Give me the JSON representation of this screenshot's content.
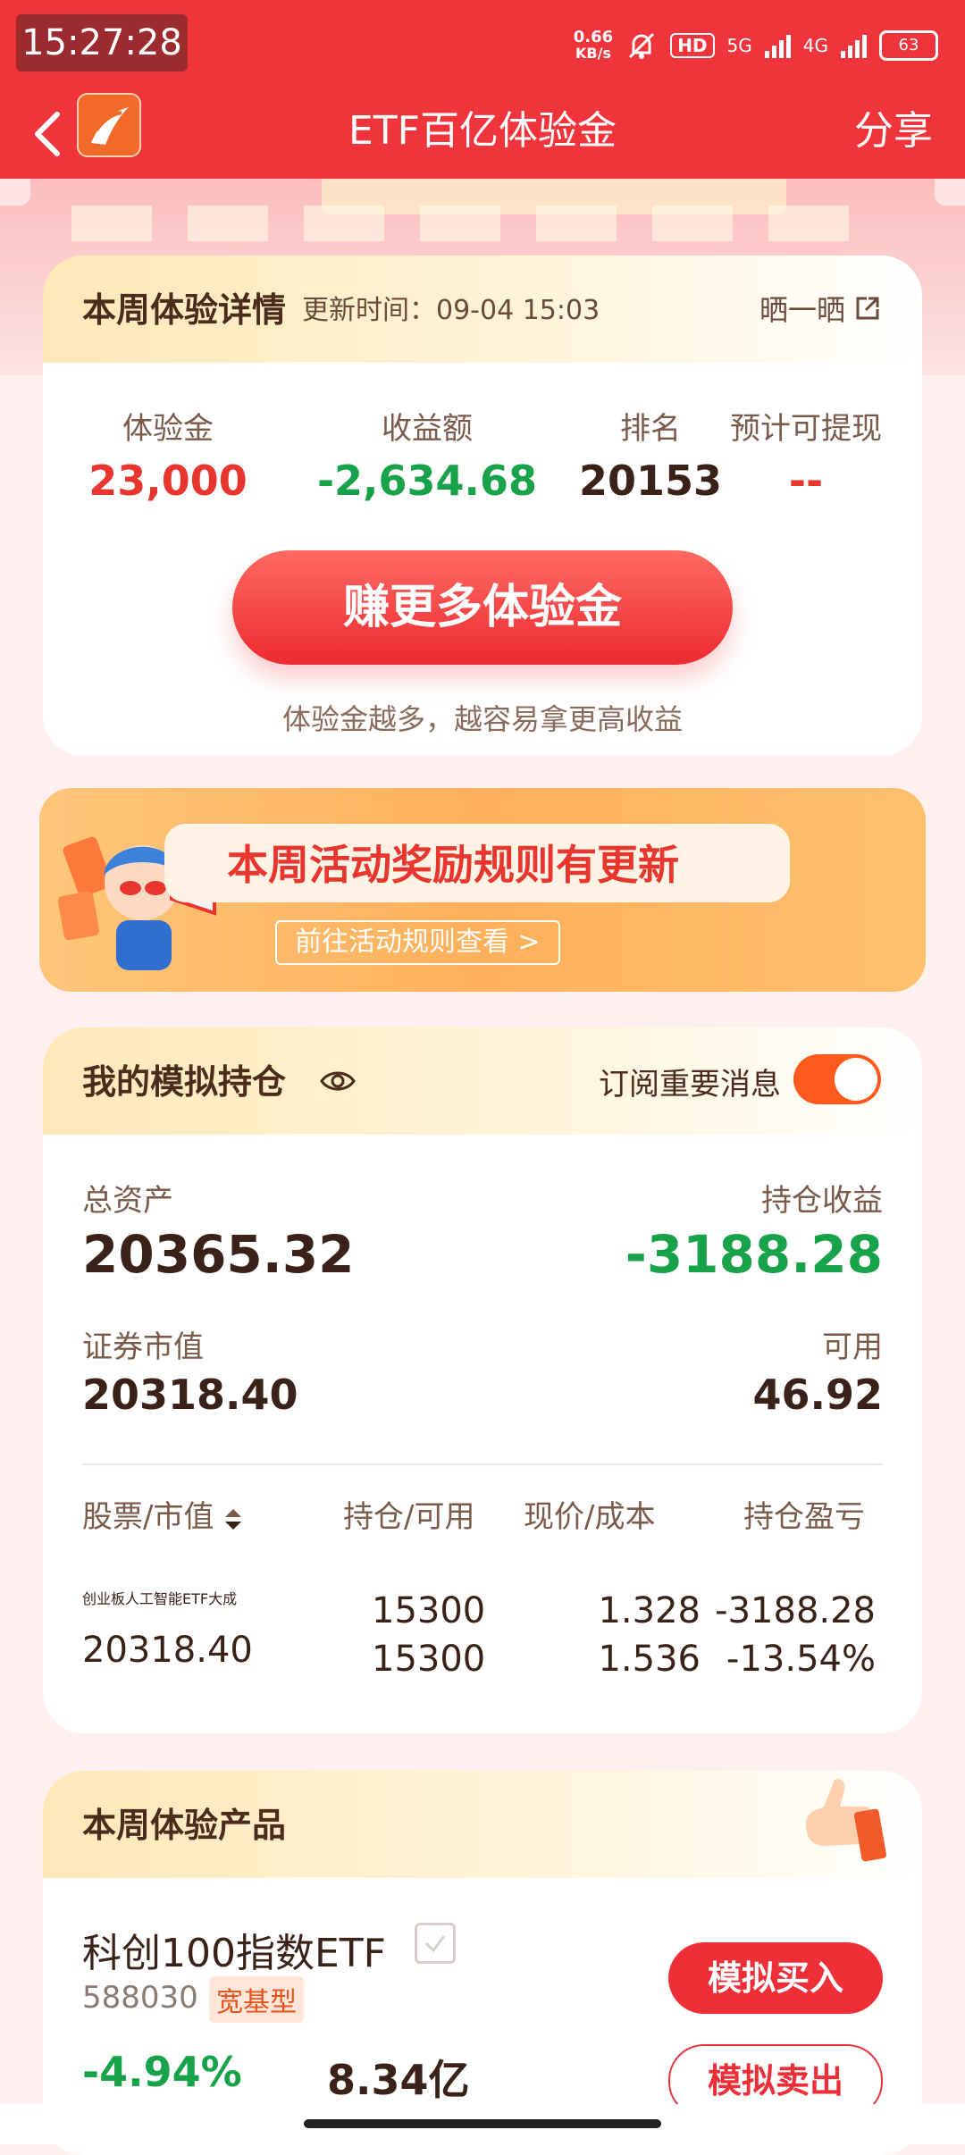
{
  "status_bar": {
    "time": "15:27:28",
    "net_speed": "0.66",
    "net_unit": "KB/s",
    "hd": "HD",
    "sig1": "5G",
    "sig2": "4G",
    "battery": "63"
  },
  "nav": {
    "title": "ETF百亿体验金",
    "share": "分享"
  },
  "weekly": {
    "title": "本周体验详情",
    "update_label": "更新时间：",
    "update_time": "09-04 15:03",
    "show_label": "晒一晒",
    "stats": [
      {
        "label": "体验金",
        "value": "23,000"
      },
      {
        "label": "收益额",
        "value": "-2,634.68"
      },
      {
        "label": "排名",
        "value": "20153"
      },
      {
        "label": "预计可提现",
        "value": "--"
      }
    ],
    "earn_button": "赚更多体验金",
    "earn_note": "体验金越多，越容易拿更高收益"
  },
  "promo": {
    "title": "本周活动奖励规则有更新",
    "link": "前往活动规则查看 >"
  },
  "holdings": {
    "title": "我的模拟持仓",
    "subscribe_label": "订阅重要消息",
    "subscribe_on": true,
    "total_assets_label": "总资产",
    "total_assets": "20365.32",
    "profit_label": "持仓收益",
    "profit": "-3188.28",
    "market_value_label": "证券市值",
    "market_value": "20318.40",
    "available_label": "可用",
    "available": "46.92",
    "columns": [
      "股票/市值",
      "持仓/可用",
      "现价/成本",
      "持仓盈亏"
    ],
    "rows": [
      {
        "name": "创业板人工智能ETF大成",
        "market_value": "20318.40",
        "position": "15300",
        "available": "15300",
        "price": "1.328",
        "cost": "1.536",
        "pl": "-3188.28",
        "pl_pct": "-13.54%"
      }
    ]
  },
  "products": {
    "title": "本周体验产品",
    "items": [
      {
        "name": "科创100指数ETF",
        "code": "588030",
        "tag": "宽基型",
        "change": "-4.94%",
        "scale": "8.34亿",
        "buy": "模拟买入",
        "sell": "模拟卖出"
      }
    ]
  }
}
